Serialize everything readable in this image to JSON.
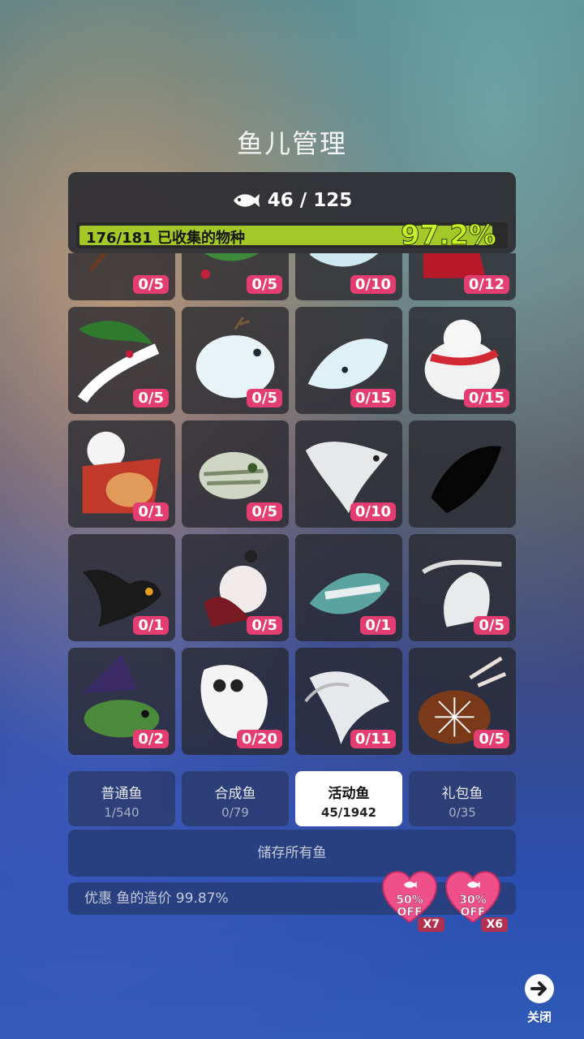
{
  "title": "鱼儿管理",
  "header": {
    "fish_count": "46 / 125",
    "species_label": "176/181 已收集的物种",
    "species_percent_text": "97.2%",
    "species_progress": 0.972
  },
  "grid": {
    "cells": [
      {
        "name": "reindeer-fish",
        "count": "0/5"
      },
      {
        "name": "holly-fish",
        "count": "0/5"
      },
      {
        "name": "ice-fish",
        "count": "0/10"
      },
      {
        "name": "santa-hat-fish",
        "count": "0/12"
      },
      {
        "name": "holly-eel",
        "count": "0/5"
      },
      {
        "name": "snow-pufferfish",
        "count": "0/5"
      },
      {
        "name": "snow-whale",
        "count": "0/15"
      },
      {
        "name": "polar-bear-fish",
        "count": "0/15"
      },
      {
        "name": "santa-fox-fish",
        "count": "0/1"
      },
      {
        "name": "mummy-fish",
        "count": "0/5"
      },
      {
        "name": "ghost-manta",
        "count": "0/10"
      },
      {
        "name": "locked-silhouette",
        "count": ""
      },
      {
        "name": "bat-fish",
        "count": "0/1"
      },
      {
        "name": "vampire-fish",
        "count": "0/5"
      },
      {
        "name": "bandaged-fish",
        "count": "0/1"
      },
      {
        "name": "ghost-witch-fish",
        "count": "0/5"
      },
      {
        "name": "witch-hat-fish",
        "count": "0/2"
      },
      {
        "name": "ghost-fish",
        "count": "0/20"
      },
      {
        "name": "reaper-fish",
        "count": "0/11"
      },
      {
        "name": "spider-web-fish",
        "count": "0/5"
      }
    ]
  },
  "tabs": [
    {
      "label": "普通鱼",
      "count": "1/540",
      "active": false
    },
    {
      "label": "合成鱼",
      "count": "0/79",
      "active": false
    },
    {
      "label": "活动鱼",
      "count": "45/1942",
      "active": true
    },
    {
      "label": "礼包鱼",
      "count": "0/35",
      "active": false
    }
  ],
  "store_all_label": "储存所有鱼",
  "discount_label": "优惠 鱼的造价 99.87%",
  "boosts": [
    {
      "percent": "50%",
      "off": "OFF",
      "multiplier": "X7"
    },
    {
      "percent": "30%",
      "off": "OFF",
      "multiplier": "X6"
    }
  ],
  "close_label": "关闭",
  "colors": {
    "badge": "#e33d72",
    "progress_fill": "#a3c828",
    "percent_text": "#c8f028",
    "tab_active": "#ffffff",
    "heart": "#f0508a"
  }
}
